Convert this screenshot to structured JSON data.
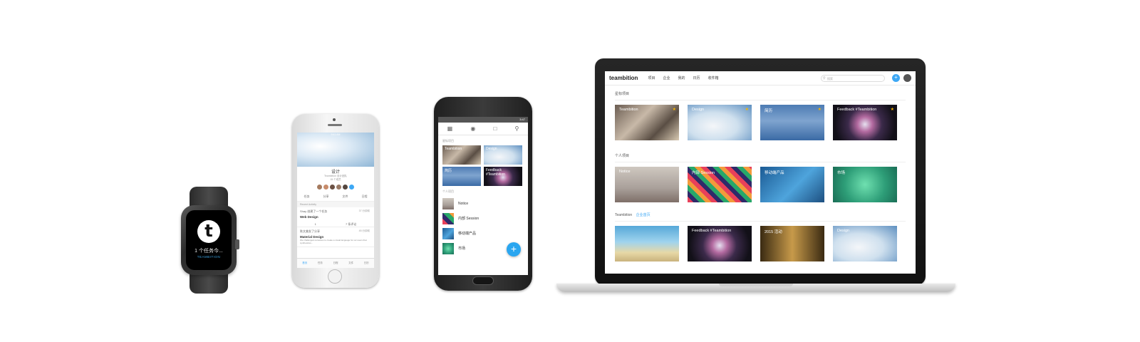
{
  "watch": {
    "logo": "t",
    "tasks_text": "1 个任务今...",
    "brand": "TEAMBITION"
  },
  "iphone": {
    "status": "9:41 AM",
    "project_title": "设计",
    "project_sub": "Teambition 设计团队",
    "member_count": "15 个成员",
    "actions": [
      "任务",
      "分享",
      "文件",
      "日程"
    ],
    "section": "Recent Activity",
    "activities": [
      {
        "meta": "Shay 创建了一个任务",
        "title": "Web Design",
        "time": "37 分钟前",
        "likes": "1",
        "comments": "7 条评论"
      },
      {
        "meta": "陈文美发了分享",
        "title": "Material Design",
        "time": "45 分钟前",
        "desc": "We challenged ourselves to create a visual language for our users that synthesizes..."
      }
    ],
    "tabbar": [
      "首页",
      "任务",
      "日程",
      "文件",
      "日历"
    ]
  },
  "android": {
    "status": "3:47",
    "starred_section": "星标项目",
    "starred": [
      {
        "label": "Teambition"
      },
      {
        "label": "Design"
      },
      {
        "label": "简历"
      },
      {
        "label": "Feedback #Teambition"
      }
    ],
    "personal_section": "个人项目",
    "personal": [
      "Notice",
      "内部 Session",
      "移动端产品",
      "市场"
    ],
    "fab": "+"
  },
  "laptop": {
    "brand": "teambition",
    "nav": [
      "项目",
      "企业",
      "我的",
      "日历",
      "收件箱"
    ],
    "search_placeholder": "搜索",
    "plus": "+",
    "sections": [
      {
        "title": "星标项目",
        "link": "",
        "cards": [
          {
            "label": "Teambition",
            "starred": true
          },
          {
            "label": "Design",
            "starred": true
          },
          {
            "label": "简历",
            "starred": true
          },
          {
            "label": "Feedback #Teambition",
            "starred": true
          }
        ]
      },
      {
        "title": "个人项目",
        "link": "",
        "cards": [
          {
            "label": "Notice"
          },
          {
            "label": "内部 Session"
          },
          {
            "label": "移动端产品"
          },
          {
            "label": "市场"
          }
        ]
      },
      {
        "title": "Teambition",
        "link": "企业首页",
        "cards": [
          {
            "label": ""
          },
          {
            "label": "Feedback #Teambition"
          },
          {
            "label": "2015 活动"
          },
          {
            "label": "Design"
          }
        ]
      }
    ]
  },
  "colors": {
    "accent": "#3da8f5",
    "star": "#f5b400"
  }
}
